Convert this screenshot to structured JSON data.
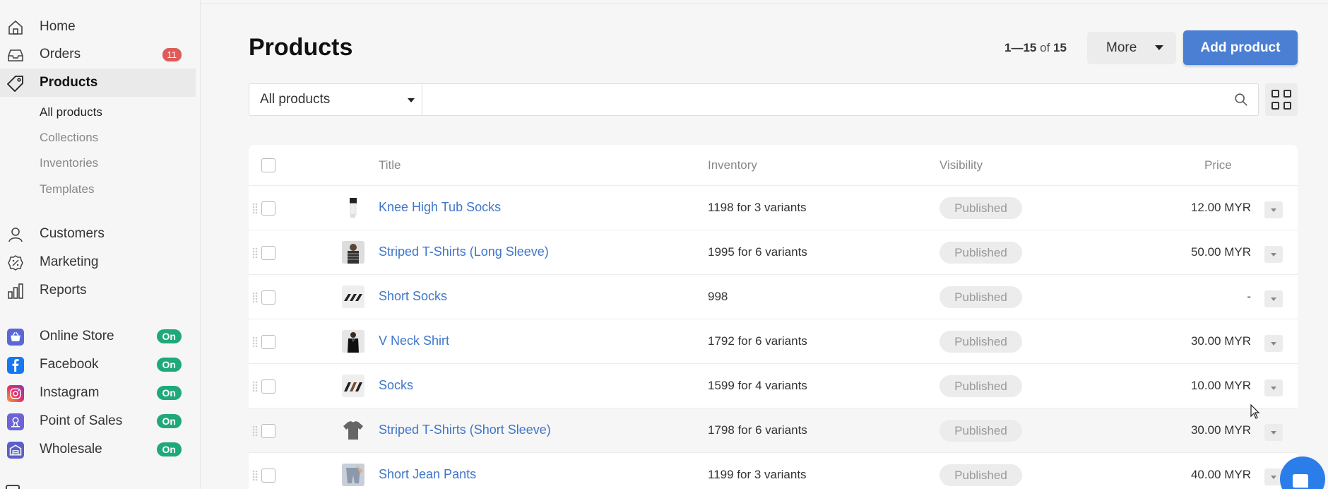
{
  "sidebar": {
    "nav": {
      "home": "Home",
      "orders": "Orders",
      "orders_badge": "11",
      "products": "Products",
      "customers": "Customers",
      "marketing": "Marketing",
      "reports": "Reports"
    },
    "products_sub": {
      "all_products": "All products",
      "collections": "Collections",
      "inventories": "Inventories",
      "templates": "Templates"
    },
    "channels": {
      "online_store": {
        "label": "Online Store",
        "status": "On"
      },
      "facebook": {
        "label": "Facebook",
        "status": "On"
      },
      "instagram": {
        "label": "Instagram",
        "status": "On"
      },
      "point_of_sales": {
        "label": "Point of Sales",
        "status": "On"
      },
      "wholesale": {
        "label": "Wholesale",
        "status": "On"
      }
    }
  },
  "header": {
    "title": "Products",
    "pager_range": "1—15",
    "pager_of": "of",
    "pager_total": "15",
    "more_label": "More",
    "add_label": "Add product"
  },
  "filter": {
    "selected": "All products",
    "search_placeholder": ""
  },
  "table": {
    "columns": {
      "title": "Title",
      "inventory": "Inventory",
      "visibility": "Visibility",
      "price": "Price"
    },
    "rows": [
      {
        "title": "Knee High Tub Socks",
        "inventory": "1198 for 3 variants",
        "visibility": "Published",
        "price": "12.00 MYR"
      },
      {
        "title": "Striped T-Shirts (Long Sleeve)",
        "inventory": "1995 for 6 variants",
        "visibility": "Published",
        "price": "50.00 MYR"
      },
      {
        "title": "Short Socks",
        "inventory": "998",
        "visibility": "Published",
        "price": "-"
      },
      {
        "title": "V Neck Shirt",
        "inventory": "1792 for 6 variants",
        "visibility": "Published",
        "price": "30.00 MYR"
      },
      {
        "title": "Socks",
        "inventory": "1599 for 4 variants",
        "visibility": "Published",
        "price": "10.00 MYR"
      },
      {
        "title": "Striped T-Shirts (Short Sleeve)",
        "inventory": "1798 for 6 variants",
        "visibility": "Published",
        "price": "30.00 MYR"
      },
      {
        "title": "Short Jean Pants",
        "inventory": "1199 for 3 variants",
        "visibility": "Published",
        "price": "40.00 MYR"
      }
    ]
  },
  "colors": {
    "accent": "#4a7fd4",
    "link": "#3f76c9",
    "badge_red": "#e05a57",
    "on_green": "#1fa97a",
    "chat": "#2b7de9"
  }
}
